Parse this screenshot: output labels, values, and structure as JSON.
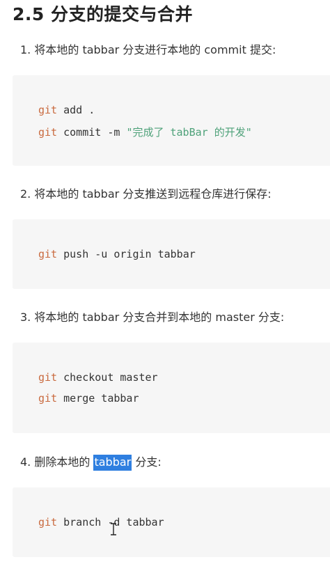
{
  "section": {
    "title": "2.5 分支的提交与合并"
  },
  "steps": [
    {
      "text": "1. 将本地的 tabbar 分支进行本地的 commit 提交:",
      "code": [
        {
          "cmd": "git",
          "rest": "add ."
        },
        {
          "cmd": "git",
          "rest": "commit -m ",
          "string": "\"完成了 tabBar 的开发\""
        }
      ]
    },
    {
      "text": "2. 将本地的 tabbar 分支推送到远程仓库进行保存:",
      "code": [
        {
          "cmd": "git",
          "rest": "push -u origin tabbar"
        }
      ]
    },
    {
      "text": "3. 将本地的 tabbar 分支合并到本地的 master 分支:",
      "code": [
        {
          "cmd": "git",
          "rest": "checkout master"
        },
        {
          "cmd": "git",
          "rest": "merge tabbar"
        }
      ]
    },
    {
      "text_before": "4. 删除本地的 ",
      "text_selected": "tabbar",
      "text_after": " 分支:",
      "code": [
        {
          "cmd": "git",
          "rest": "branch -d tabbar"
        }
      ]
    }
  ],
  "colors": {
    "code_background": "#f6f6f6",
    "keyword": "#c96a3f",
    "string": "#4fa27a",
    "selection": "#2f7fe0"
  }
}
